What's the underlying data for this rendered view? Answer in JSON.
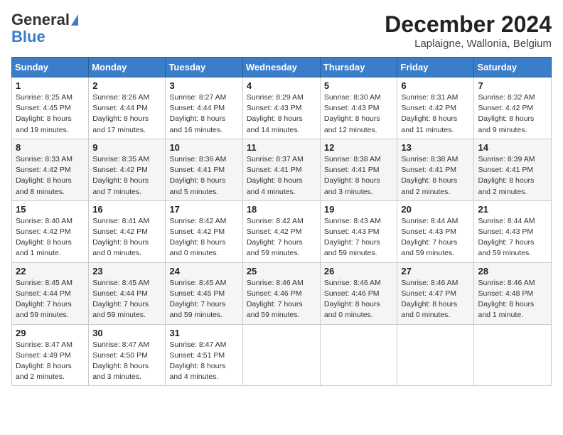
{
  "header": {
    "logo_general": "General",
    "logo_blue": "Blue",
    "month_title": "December 2024",
    "location": "Laplaigne, Wallonia, Belgium"
  },
  "days_of_week": [
    "Sunday",
    "Monday",
    "Tuesday",
    "Wednesday",
    "Thursday",
    "Friday",
    "Saturday"
  ],
  "weeks": [
    [
      {
        "day": "1",
        "sunrise": "8:25 AM",
        "sunset": "4:45 PM",
        "daylight": "8 hours and 19 minutes."
      },
      {
        "day": "2",
        "sunrise": "8:26 AM",
        "sunset": "4:44 PM",
        "daylight": "8 hours and 17 minutes."
      },
      {
        "day": "3",
        "sunrise": "8:27 AM",
        "sunset": "4:44 PM",
        "daylight": "8 hours and 16 minutes."
      },
      {
        "day": "4",
        "sunrise": "8:29 AM",
        "sunset": "4:43 PM",
        "daylight": "8 hours and 14 minutes."
      },
      {
        "day": "5",
        "sunrise": "8:30 AM",
        "sunset": "4:43 PM",
        "daylight": "8 hours and 12 minutes."
      },
      {
        "day": "6",
        "sunrise": "8:31 AM",
        "sunset": "4:42 PM",
        "daylight": "8 hours and 11 minutes."
      },
      {
        "day": "7",
        "sunrise": "8:32 AM",
        "sunset": "4:42 PM",
        "daylight": "8 hours and 9 minutes."
      }
    ],
    [
      {
        "day": "8",
        "sunrise": "8:33 AM",
        "sunset": "4:42 PM",
        "daylight": "8 hours and 8 minutes."
      },
      {
        "day": "9",
        "sunrise": "8:35 AM",
        "sunset": "4:42 PM",
        "daylight": "8 hours and 7 minutes."
      },
      {
        "day": "10",
        "sunrise": "8:36 AM",
        "sunset": "4:41 PM",
        "daylight": "8 hours and 5 minutes."
      },
      {
        "day": "11",
        "sunrise": "8:37 AM",
        "sunset": "4:41 PM",
        "daylight": "8 hours and 4 minutes."
      },
      {
        "day": "12",
        "sunrise": "8:38 AM",
        "sunset": "4:41 PM",
        "daylight": "8 hours and 3 minutes."
      },
      {
        "day": "13",
        "sunrise": "8:38 AM",
        "sunset": "4:41 PM",
        "daylight": "8 hours and 2 minutes."
      },
      {
        "day": "14",
        "sunrise": "8:39 AM",
        "sunset": "4:41 PM",
        "daylight": "8 hours and 2 minutes."
      }
    ],
    [
      {
        "day": "15",
        "sunrise": "8:40 AM",
        "sunset": "4:42 PM",
        "daylight": "8 hours and 1 minute."
      },
      {
        "day": "16",
        "sunrise": "8:41 AM",
        "sunset": "4:42 PM",
        "daylight": "8 hours and 0 minutes."
      },
      {
        "day": "17",
        "sunrise": "8:42 AM",
        "sunset": "4:42 PM",
        "daylight": "8 hours and 0 minutes."
      },
      {
        "day": "18",
        "sunrise": "8:42 AM",
        "sunset": "4:42 PM",
        "daylight": "7 hours and 59 minutes."
      },
      {
        "day": "19",
        "sunrise": "8:43 AM",
        "sunset": "4:43 PM",
        "daylight": "7 hours and 59 minutes."
      },
      {
        "day": "20",
        "sunrise": "8:44 AM",
        "sunset": "4:43 PM",
        "daylight": "7 hours and 59 minutes."
      },
      {
        "day": "21",
        "sunrise": "8:44 AM",
        "sunset": "4:43 PM",
        "daylight": "7 hours and 59 minutes."
      }
    ],
    [
      {
        "day": "22",
        "sunrise": "8:45 AM",
        "sunset": "4:44 PM",
        "daylight": "7 hours and 59 minutes."
      },
      {
        "day": "23",
        "sunrise": "8:45 AM",
        "sunset": "4:44 PM",
        "daylight": "7 hours and 59 minutes."
      },
      {
        "day": "24",
        "sunrise": "8:45 AM",
        "sunset": "4:45 PM",
        "daylight": "7 hours and 59 minutes."
      },
      {
        "day": "25",
        "sunrise": "8:46 AM",
        "sunset": "4:46 PM",
        "daylight": "7 hours and 59 minutes."
      },
      {
        "day": "26",
        "sunrise": "8:46 AM",
        "sunset": "4:46 PM",
        "daylight": "8 hours and 0 minutes."
      },
      {
        "day": "27",
        "sunrise": "8:46 AM",
        "sunset": "4:47 PM",
        "daylight": "8 hours and 0 minutes."
      },
      {
        "day": "28",
        "sunrise": "8:46 AM",
        "sunset": "4:48 PM",
        "daylight": "8 hours and 1 minute."
      }
    ],
    [
      {
        "day": "29",
        "sunrise": "8:47 AM",
        "sunset": "4:49 PM",
        "daylight": "8 hours and 2 minutes."
      },
      {
        "day": "30",
        "sunrise": "8:47 AM",
        "sunset": "4:50 PM",
        "daylight": "8 hours and 3 minutes."
      },
      {
        "day": "31",
        "sunrise": "8:47 AM",
        "sunset": "4:51 PM",
        "daylight": "8 hours and 4 minutes."
      },
      null,
      null,
      null,
      null
    ]
  ]
}
